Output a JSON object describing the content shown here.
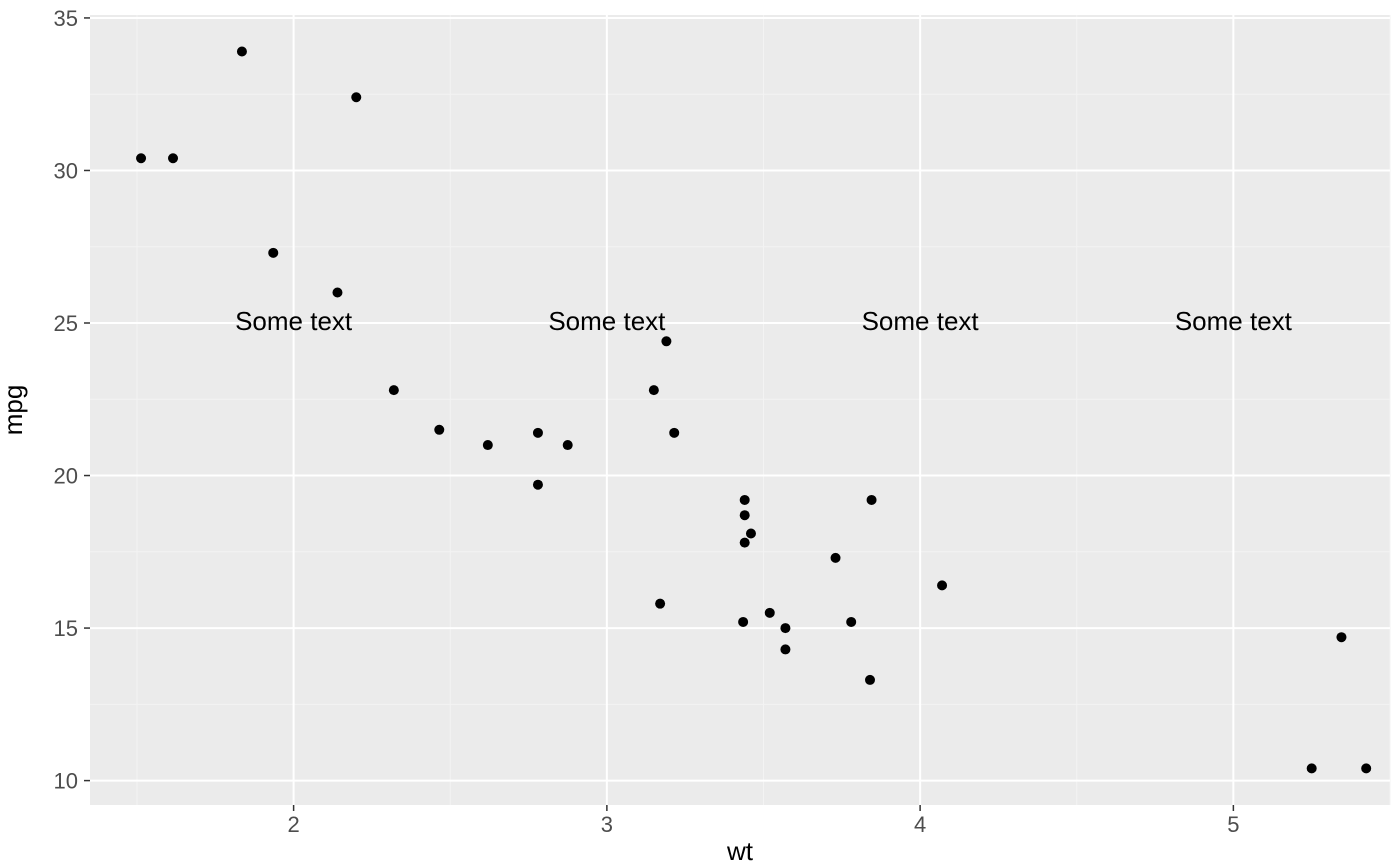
{
  "chart_data": {
    "type": "scatter",
    "xlabel": "wt",
    "ylabel": "mpg",
    "xlim": [
      1.35,
      5.5
    ],
    "ylim": [
      9.2,
      35.1
    ],
    "x_major_ticks": [
      2,
      3,
      4,
      5
    ],
    "y_major_ticks": [
      10,
      15,
      20,
      25,
      30,
      35
    ],
    "x_minor_gridlines": [
      1.5,
      2.5,
      3.5,
      4.5,
      5.5
    ],
    "y_minor_gridlines": [
      12.5,
      17.5,
      22.5,
      27.5,
      32.5
    ],
    "points": [
      {
        "x": 2.62,
        "y": 21.0
      },
      {
        "x": 2.875,
        "y": 21.0
      },
      {
        "x": 2.32,
        "y": 22.8
      },
      {
        "x": 3.215,
        "y": 21.4
      },
      {
        "x": 3.44,
        "y": 18.7
      },
      {
        "x": 3.46,
        "y": 18.1
      },
      {
        "x": 3.57,
        "y": 14.3
      },
      {
        "x": 3.19,
        "y": 24.4
      },
      {
        "x": 3.15,
        "y": 22.8
      },
      {
        "x": 3.44,
        "y": 19.2
      },
      {
        "x": 3.44,
        "y": 17.8
      },
      {
        "x": 4.07,
        "y": 16.4
      },
      {
        "x": 3.73,
        "y": 17.3
      },
      {
        "x": 3.78,
        "y": 15.2
      },
      {
        "x": 5.25,
        "y": 10.4
      },
      {
        "x": 5.424,
        "y": 10.4
      },
      {
        "x": 5.345,
        "y": 14.7
      },
      {
        "x": 2.2,
        "y": 32.4
      },
      {
        "x": 1.615,
        "y": 30.4
      },
      {
        "x": 1.835,
        "y": 33.9
      },
      {
        "x": 2.465,
        "y": 21.5
      },
      {
        "x": 3.52,
        "y": 15.5
      },
      {
        "x": 3.435,
        "y": 15.2
      },
      {
        "x": 3.84,
        "y": 13.3
      },
      {
        "x": 3.845,
        "y": 19.2
      },
      {
        "x": 1.935,
        "y": 27.3
      },
      {
        "x": 2.14,
        "y": 26.0
      },
      {
        "x": 1.513,
        "y": 30.4
      },
      {
        "x": 3.17,
        "y": 15.8
      },
      {
        "x": 2.77,
        "y": 19.7
      },
      {
        "x": 3.57,
        "y": 15.0
      },
      {
        "x": 2.78,
        "y": 21.4
      }
    ],
    "annotations": [
      {
        "x": 2.0,
        "y": 25,
        "label": "Some text"
      },
      {
        "x": 3.0,
        "y": 25,
        "label": "Some text"
      },
      {
        "x": 4.0,
        "y": 25,
        "label": "Some text"
      },
      {
        "x": 5.0,
        "y": 25,
        "label": "Some text"
      }
    ]
  },
  "x_tick_labels": {
    "t0": "2",
    "t1": "3",
    "t2": "4",
    "t3": "5"
  },
  "y_tick_labels": {
    "t0": "10",
    "t1": "15",
    "t2": "20",
    "t3": "25",
    "t4": "30",
    "t5": "35"
  }
}
